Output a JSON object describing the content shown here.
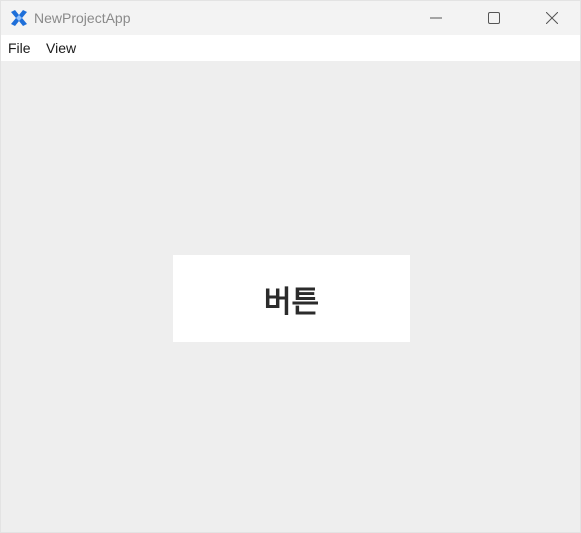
{
  "window": {
    "title": "NewProjectApp",
    "icon": "app-logo-icon",
    "controls": {
      "minimize_icon": "minimize-icon",
      "maximize_icon": "maximize-icon",
      "close_icon": "close-icon"
    }
  },
  "menubar": {
    "items": [
      {
        "label": "File"
      },
      {
        "label": "View"
      }
    ]
  },
  "main": {
    "button_label": "버튼"
  },
  "colors": {
    "background": "#eeeeee",
    "titlebar": "#f3f3f3",
    "menubar": "#ffffff",
    "button_bg": "#ffffff",
    "button_text": "#2b2b2b",
    "icon_accent": "#1e6fd9"
  }
}
